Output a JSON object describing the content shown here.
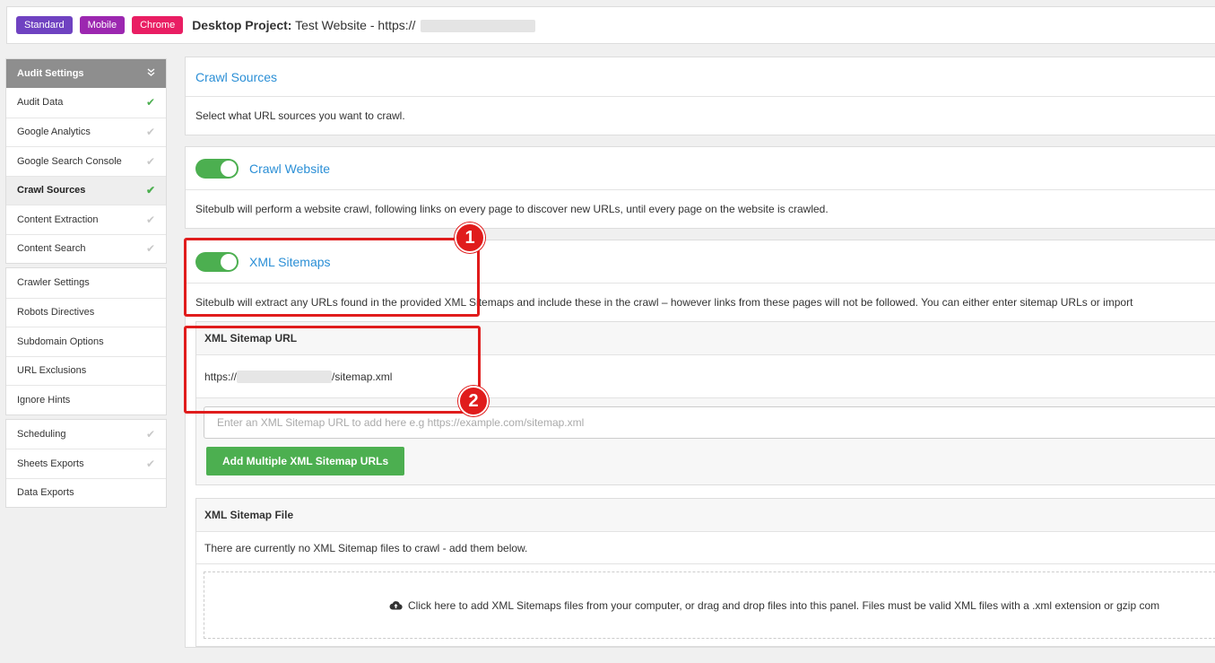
{
  "header": {
    "tags": [
      "Standard",
      "Mobile",
      "Chrome"
    ],
    "project_label": "Desktop Project:",
    "project_name": "Test Website - https://"
  },
  "sidebar": {
    "group1_title": "Audit Settings",
    "group1_items": [
      {
        "label": "Audit Data",
        "check": "done"
      },
      {
        "label": "Google Analytics",
        "check": "pending"
      },
      {
        "label": "Google Search Console",
        "check": "pending"
      },
      {
        "label": "Crawl Sources",
        "check": "done"
      },
      {
        "label": "Content Extraction",
        "check": "pending"
      },
      {
        "label": "Content Search",
        "check": "pending"
      }
    ],
    "group2_items": [
      {
        "label": "Crawler Settings"
      },
      {
        "label": "Robots Directives"
      },
      {
        "label": "Subdomain Options"
      },
      {
        "label": "URL Exclusions"
      },
      {
        "label": "Ignore Hints"
      }
    ],
    "group3_items": [
      {
        "label": "Scheduling",
        "check": "pending"
      },
      {
        "label": "Sheets Exports",
        "check": "pending"
      },
      {
        "label": "Data Exports"
      }
    ]
  },
  "crawl_sources": {
    "title": "Crawl Sources",
    "description": "Select what URL sources you want to crawl."
  },
  "crawl_website": {
    "title": "Crawl Website",
    "enabled": true,
    "description": "Sitebulb will perform a website crawl, following links on every page to discover new URLs, until every page on the website is crawled."
  },
  "xml_sitemaps": {
    "title": "XML Sitemaps",
    "enabled": true,
    "description": "Sitebulb will extract any URLs found in the provided XML Sitemaps and include these in the crawl – however links from these pages will not be followed. You can either enter sitemap URLs or import"
  },
  "sitemap_url": {
    "heading": "XML Sitemap URL",
    "url_prefix": "https://",
    "url_suffix": "/sitemap.xml",
    "input_placeholder": "Enter an XML Sitemap URL to add here e.g https://example.com/sitemap.xml",
    "add_button": "Add Multiple XML Sitemap URLs"
  },
  "sitemap_file": {
    "heading": "XML Sitemap File",
    "status": "There are currently no XML Sitemap files to crawl - add them below.",
    "dropzone_text": "Click here to add XML Sitemaps files from your computer, or drag and drop files into this panel. Files must be valid XML files with a .xml extension or gzip com"
  },
  "annotations": [
    "1",
    "2"
  ],
  "colors": {
    "accent_blue": "#2b8fd6",
    "toggle_green": "#4caf50",
    "highlight_red": "#e01c1c",
    "tag_standard": "#6f42c1",
    "tag_mobile": "#9c27b0",
    "tag_chrome": "#e91e63"
  }
}
